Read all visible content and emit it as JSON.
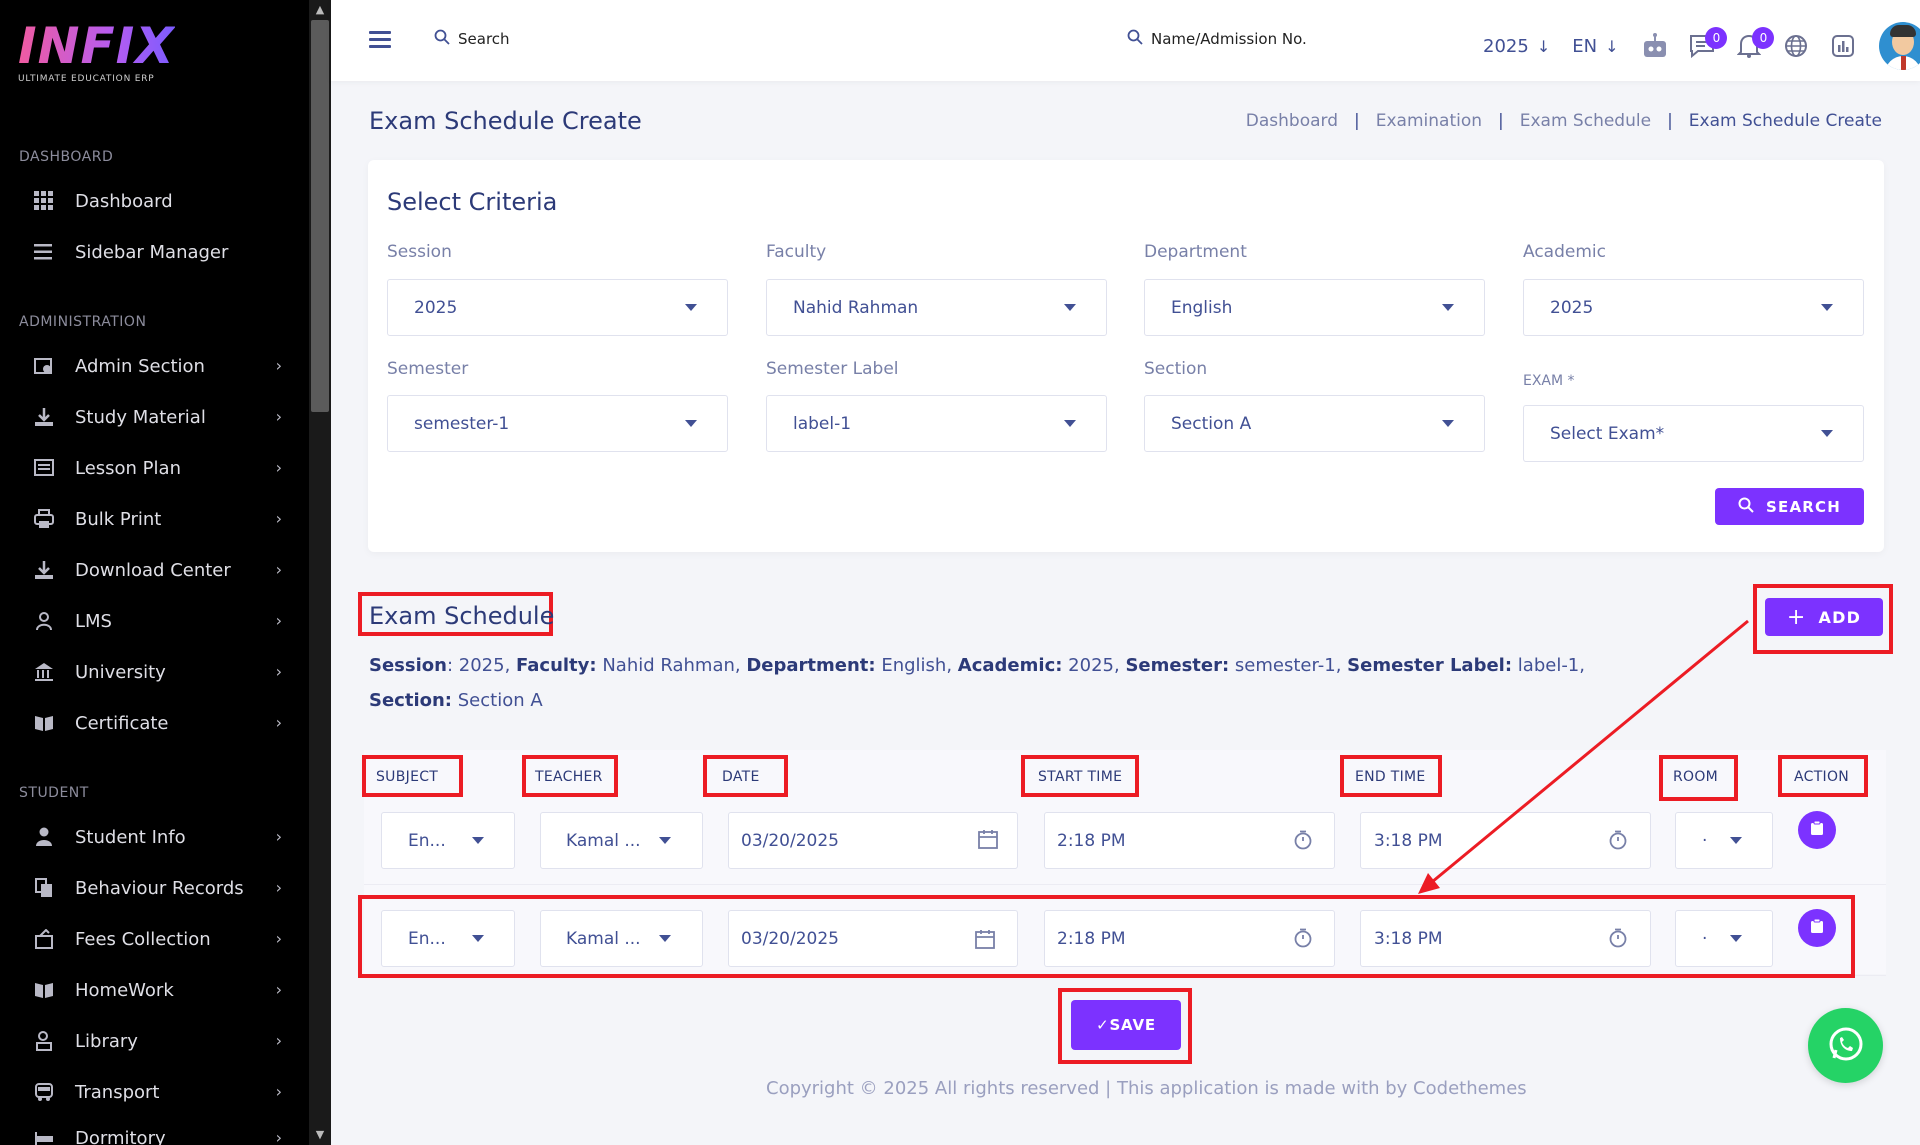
{
  "brand": {
    "name": "INFIX",
    "tagline": "ULTIMATE EDUCATION ERP"
  },
  "sidebar": {
    "sections": [
      {
        "label": "DASHBOARD"
      },
      {
        "label": "ADMINISTRATION"
      },
      {
        "label": "STUDENT"
      }
    ],
    "items": [
      {
        "label": "Dashboard",
        "icon": "grid-icon"
      },
      {
        "label": "Sidebar Manager",
        "icon": "menu-icon"
      },
      {
        "label": "Admin Section",
        "icon": "admin-icon"
      },
      {
        "label": "Study Material",
        "icon": "download-icon"
      },
      {
        "label": "Lesson Plan",
        "icon": "list-icon"
      },
      {
        "label": "Bulk Print",
        "icon": "printer-icon"
      },
      {
        "label": "Download Center",
        "icon": "download-icon"
      },
      {
        "label": "LMS",
        "icon": "lms-icon"
      },
      {
        "label": "University",
        "icon": "university-icon"
      },
      {
        "label": "Certificate",
        "icon": "book-icon"
      },
      {
        "label": "Student Info",
        "icon": "user-icon"
      },
      {
        "label": "Behaviour Records",
        "icon": "records-icon"
      },
      {
        "label": "Fees Collection",
        "icon": "fees-icon"
      },
      {
        "label": "HomeWork",
        "icon": "book-icon"
      },
      {
        "label": "Library",
        "icon": "library-icon"
      },
      {
        "label": "Transport",
        "icon": "bus-icon"
      },
      {
        "label": "Dormitory",
        "icon": "bed-icon"
      }
    ]
  },
  "topbar": {
    "search_label": "Search",
    "student_search_label": "Name/Admission No.",
    "year": "2025",
    "lang": "EN",
    "message_count": "0",
    "notification_count": "0"
  },
  "page": {
    "title": "Exam Schedule Create",
    "breadcrumbs": [
      "Dashboard",
      "Examination",
      "Exam Schedule",
      "Exam Schedule Create"
    ]
  },
  "criteria": {
    "title": "Select Criteria",
    "fields": [
      {
        "label": "Session",
        "value": "2025"
      },
      {
        "label": "Faculty",
        "value": "Nahid Rahman"
      },
      {
        "label": "Department",
        "value": "English"
      },
      {
        "label": "Academic",
        "value": "2025"
      },
      {
        "label": "Semester",
        "value": "semester-1"
      },
      {
        "label": "Semester Label",
        "value": "label-1"
      },
      {
        "label": "Section",
        "value": "Section A"
      },
      {
        "label": "EXAM *",
        "value": "Select Exam*"
      }
    ],
    "search_button": "SEARCH"
  },
  "schedule": {
    "title": "Exam Schedule",
    "add_button": "ADD",
    "info": [
      {
        "key": "Session",
        "value": "2025"
      },
      {
        "key": "Faculty:",
        "value": "Nahid Rahman"
      },
      {
        "key": "Department:",
        "value": "English"
      },
      {
        "key": "Academic:",
        "value": "2025"
      },
      {
        "key": "Semester:",
        "value": "semester-1"
      },
      {
        "key": "Semester Label:",
        "value": "label-1"
      },
      {
        "key": "Section:",
        "value": "Section A"
      }
    ],
    "columns": [
      "SUBJECT",
      "TEACHER",
      "DATE",
      "START TIME",
      "END TIME",
      "ROOM",
      "ACTION"
    ],
    "rows": [
      {
        "subject": "En...",
        "teacher": "Kamal ...",
        "date": "03/20/2025",
        "start": "2:18 PM",
        "end": "3:18 PM",
        "room": "·"
      },
      {
        "subject": "En...",
        "teacher": "Kamal ...",
        "date": "03/20/2025",
        "start": "2:18 PM",
        "end": "3:18 PM",
        "room": "·"
      }
    ],
    "save_button": "✓SAVE"
  },
  "footer": {
    "text": "Copyright © 2025 All rights reserved | This application is made with by Codethemes"
  },
  "colors": {
    "accent": "#7c32ff",
    "annotation": "#ec1c24",
    "sidebar": "#000000",
    "text": "#415094"
  }
}
